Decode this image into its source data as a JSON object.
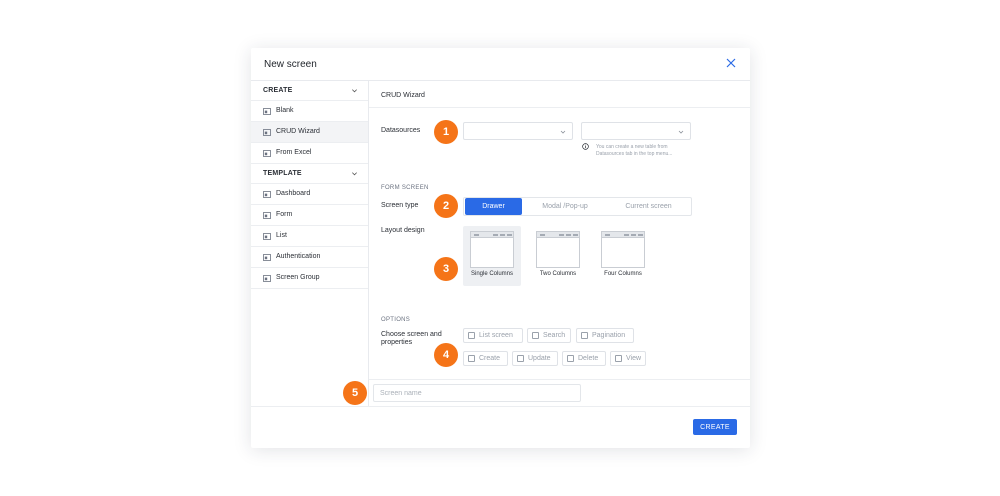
{
  "dialog": {
    "title": "New screen"
  },
  "sidebar": {
    "sections": [
      {
        "label": "CREATE",
        "items": [
          {
            "label": "Blank"
          },
          {
            "label": "CRUD Wizard"
          },
          {
            "label": "From Excel"
          }
        ]
      },
      {
        "label": "TEMPLATE",
        "items": [
          {
            "label": "Dashboard"
          },
          {
            "label": "Form"
          },
          {
            "label": "List"
          },
          {
            "label": "Authentication"
          },
          {
            "label": "Screen Group"
          }
        ]
      }
    ]
  },
  "main": {
    "title": "CRUD Wizard",
    "datasources": {
      "label": "Datasources",
      "hint_line1": "You can create a new table from",
      "hint_line2": "Datasources tab in the top menu..."
    },
    "form_screen": {
      "section_label": "FORM SCREEN",
      "screen_type_label": "Screen type",
      "screen_types": [
        "Drawer",
        "Modal /Pop-up",
        "Current screen"
      ],
      "selected_screen_type": "Drawer",
      "layout_label": "Layout design",
      "layouts": [
        "Single Columns",
        "Two Columns",
        "Four Columns"
      ],
      "selected_layout": "Single Columns"
    },
    "options": {
      "section_label": "OPTIONS",
      "choose_label_line1": "Choose screen and",
      "choose_label_line2": "properties",
      "checkboxes": [
        "List screen",
        "Search",
        "Pagination",
        "Create",
        "Update",
        "Delete",
        "View"
      ]
    },
    "screen_name": {
      "placeholder": "Screen name"
    }
  },
  "footer": {
    "create_label": "CREATE"
  },
  "callouts": [
    "1",
    "2",
    "3",
    "4",
    "5"
  ],
  "colors": {
    "accent": "#2a6ae6",
    "callout": "#f57418"
  }
}
